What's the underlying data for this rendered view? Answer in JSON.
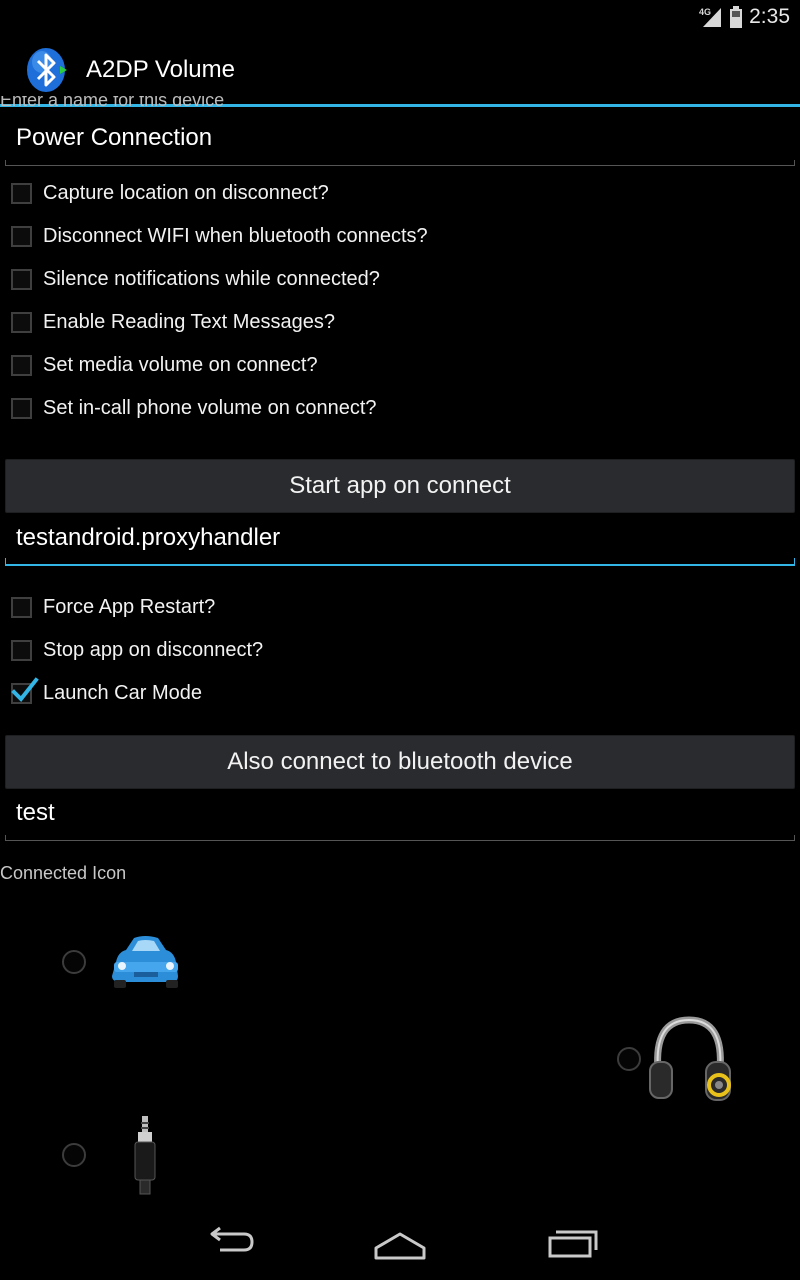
{
  "status_bar": {
    "network": "4G",
    "time": "2:35"
  },
  "app": {
    "title": "A2DP Volume",
    "icon": "bluetooth-icon"
  },
  "form": {
    "name_label": "Enter a name for this device",
    "name_value": "Power Connection",
    "checkboxes_top": [
      {
        "label": "Capture location on disconnect?",
        "checked": false
      },
      {
        "label": "Disconnect WIFI when bluetooth connects?",
        "checked": false
      },
      {
        "label": "Silence notifications while connected?",
        "checked": false
      },
      {
        "label": "Enable Reading Text Messages?",
        "checked": false
      },
      {
        "label": "Set media volume on connect?",
        "checked": false
      },
      {
        "label": "Set in-call phone volume on connect?",
        "checked": false
      }
    ],
    "start_app_button": "Start app on connect",
    "app_value": "testandroid.proxyhandler",
    "checkboxes_app": [
      {
        "label": "Force App Restart?",
        "checked": false
      },
      {
        "label": "Stop app on disconnect?",
        "checked": false
      },
      {
        "label": "Launch Car Mode",
        "checked": true
      }
    ],
    "also_connect_button": "Also connect to bluetooth device",
    "bt_device_value": "test",
    "connected_icon_label": "Connected Icon",
    "icon_options": [
      {
        "icon": "car-icon",
        "selected": false
      },
      {
        "icon": "headphones-icon",
        "selected": false
      },
      {
        "icon": "audio-jack-icon",
        "selected": false
      }
    ]
  },
  "colors": {
    "accent": "#33b5e5",
    "button_bg": "#292b2e",
    "background": "#000000"
  },
  "nav": {
    "buttons": [
      "back-icon",
      "home-icon",
      "recents-icon"
    ]
  }
}
